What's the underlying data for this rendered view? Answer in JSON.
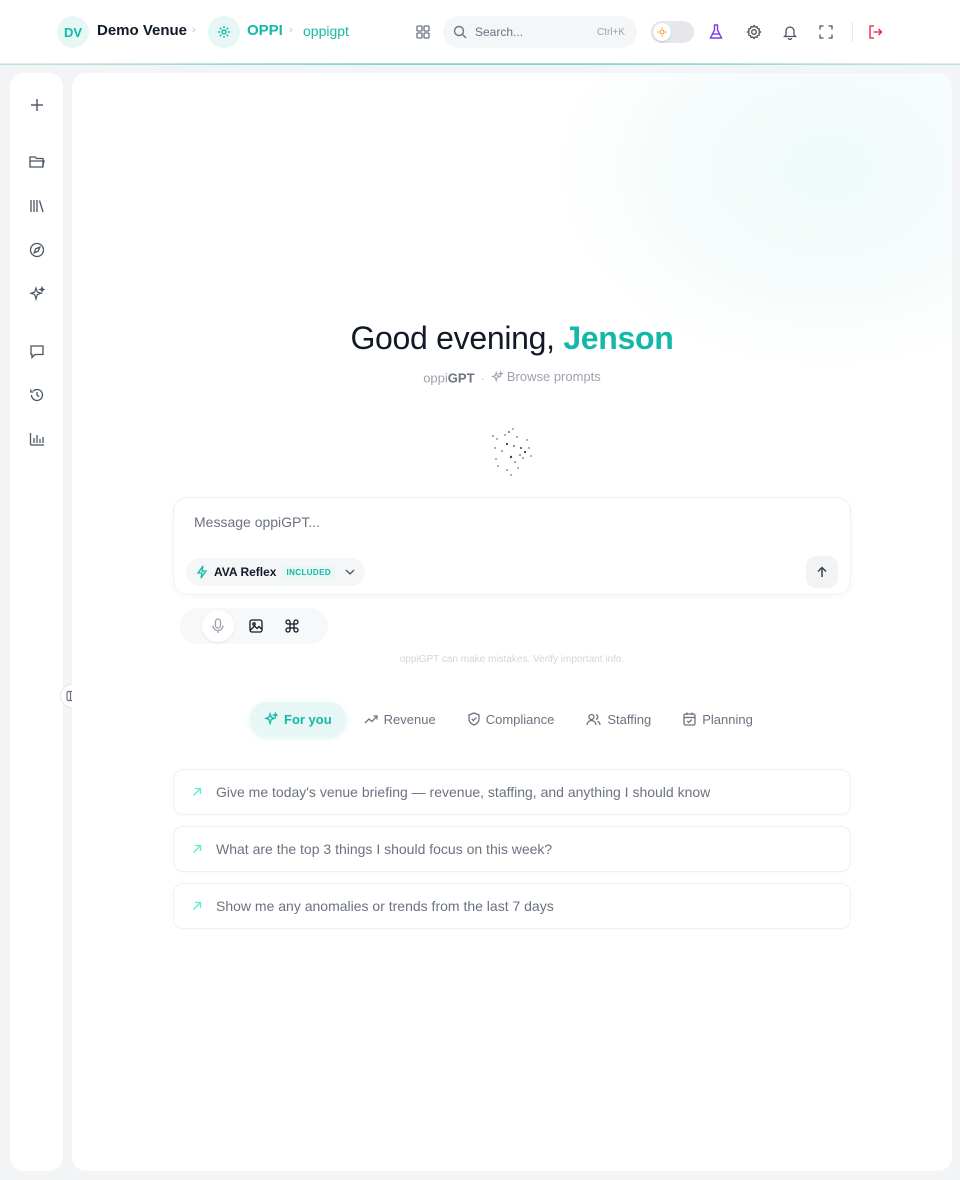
{
  "header": {
    "venue_initials": "DV",
    "venue_name": "Demo Venue",
    "app_name": "OPPI",
    "current_page": "oppigpt",
    "search_placeholder": "Search...",
    "search_shortcut": "Ctrl+K",
    "icons": [
      "apps-grid-icon",
      "search-icon",
      "sun-icon",
      "flask-icon",
      "settings-icon",
      "bell-icon",
      "fullscreen-icon",
      "logout-icon"
    ]
  },
  "sidebar": {
    "items": [
      {
        "name": "new",
        "icon": "plus-icon"
      },
      {
        "name": "folders",
        "icon": "folder-icon"
      },
      {
        "name": "library",
        "icon": "library-icon"
      },
      {
        "name": "explore",
        "icon": "compass-icon"
      },
      {
        "name": "sparkles",
        "icon": "sparkles-icon"
      },
      {
        "name": "chats",
        "icon": "chat-icon"
      },
      {
        "name": "history",
        "icon": "history-icon"
      },
      {
        "name": "analytics",
        "icon": "bar-chart-icon"
      }
    ]
  },
  "main": {
    "greeting_prefix": "Good evening, ",
    "user_name": "Jenson",
    "brand_light": "oppi",
    "brand_bold": "GPT",
    "separator": "·",
    "browse_prompts": "Browse prompts",
    "composer": {
      "placeholder": "Message oppiGPT...",
      "value": "",
      "model_name": "AVA Reflex",
      "model_badge": "INCLUDED"
    },
    "disclaimer": "oppiGPT can make mistakes. Verify important info.",
    "tabs": [
      {
        "label": "For you",
        "icon": "sparkles-icon",
        "active": true
      },
      {
        "label": "Revenue",
        "icon": "trending-up-icon",
        "active": false
      },
      {
        "label": "Compliance",
        "icon": "shield-check-icon",
        "active": false
      },
      {
        "label": "Staffing",
        "icon": "users-icon",
        "active": false
      },
      {
        "label": "Planning",
        "icon": "calendar-icon",
        "active": false
      }
    ],
    "suggestions": [
      "Give me today's venue briefing — revenue, staffing, and anything I should know",
      "What are the top 3 things I should focus on this week?",
      "Show me any anomalies or trends from the last 7 days"
    ]
  },
  "colors": {
    "accent": "#14b8a6",
    "accent_soft": "#e6f7f5",
    "flask": "#7c3aed",
    "logout": "#e11d48",
    "background": "#f3f4f6"
  }
}
